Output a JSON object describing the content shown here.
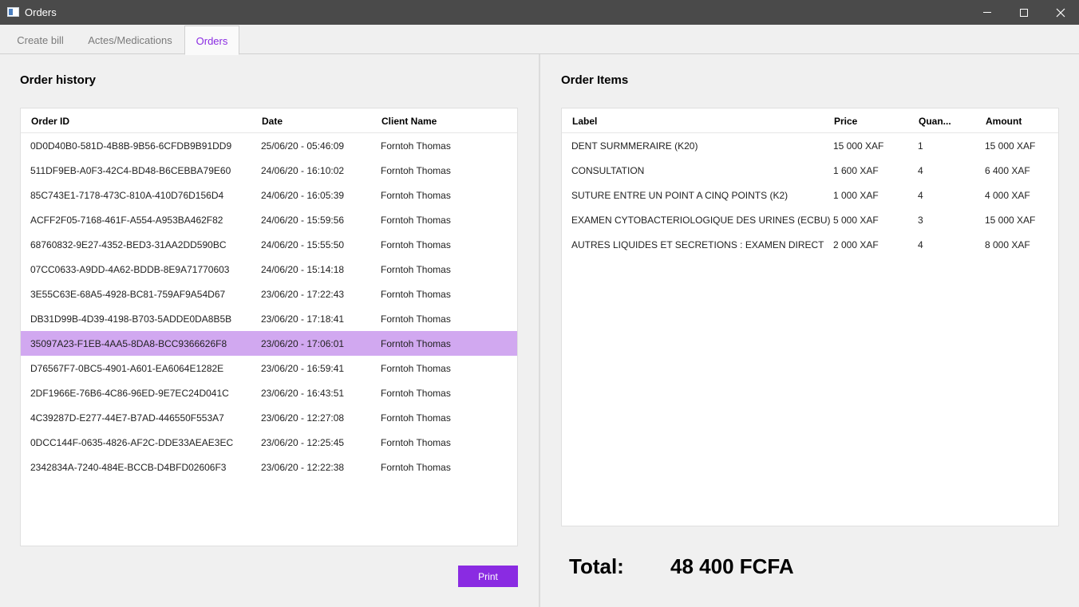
{
  "window": {
    "title": "Orders",
    "icon": "app-window-icon"
  },
  "tabs": [
    {
      "label": "Create bill",
      "active": false
    },
    {
      "label": "Actes/Medications",
      "active": false
    },
    {
      "label": "Orders",
      "active": true
    }
  ],
  "colors": {
    "accent": "#8a2be2",
    "selected_row": "#d1a8f0",
    "titlebar": "#4a4a4a"
  },
  "order_history": {
    "title": "Order history",
    "columns": [
      "Order ID",
      "Date",
      "Client Name"
    ],
    "selected_index": 8,
    "rows": [
      {
        "id": "0D0D40B0-581D-4B8B-9B56-6CFDB9B91DD9",
        "date": "25/06/20 - 05:46:09",
        "client": "Forntoh Thomas"
      },
      {
        "id": "511DF9EB-A0F3-42C4-BD48-B6CEBBA79E60",
        "date": "24/06/20 - 16:10:02",
        "client": "Forntoh Thomas"
      },
      {
        "id": "85C743E1-7178-473C-810A-410D76D156D4",
        "date": "24/06/20 - 16:05:39",
        "client": "Forntoh Thomas"
      },
      {
        "id": "ACFF2F05-7168-461F-A554-A953BA462F82",
        "date": "24/06/20 - 15:59:56",
        "client": "Forntoh Thomas"
      },
      {
        "id": "68760832-9E27-4352-BED3-31AA2DD590BC",
        "date": "24/06/20 - 15:55:50",
        "client": "Forntoh Thomas"
      },
      {
        "id": "07CC0633-A9DD-4A62-BDDB-8E9A71770603",
        "date": "24/06/20 - 15:14:18",
        "client": "Forntoh Thomas"
      },
      {
        "id": "3E55C63E-68A5-4928-BC81-759AF9A54D67",
        "date": "23/06/20 - 17:22:43",
        "client": "Forntoh Thomas"
      },
      {
        "id": "DB31D99B-4D39-4198-B703-5ADDE0DA8B5B",
        "date": "23/06/20 - 17:18:41",
        "client": "Forntoh Thomas"
      },
      {
        "id": "35097A23-F1EB-4AA5-8DA8-BCC9366626F8",
        "date": "23/06/20 - 17:06:01",
        "client": "Forntoh Thomas"
      },
      {
        "id": "D76567F7-0BC5-4901-A601-EA6064E1282E",
        "date": "23/06/20 - 16:59:41",
        "client": "Forntoh Thomas"
      },
      {
        "id": "2DF1966E-76B6-4C86-96ED-9E7EC24D041C",
        "date": "23/06/20 - 16:43:51",
        "client": "Forntoh Thomas"
      },
      {
        "id": "4C39287D-E277-44E7-B7AD-446550F553A7",
        "date": "23/06/20 - 12:27:08",
        "client": "Forntoh Thomas"
      },
      {
        "id": "0DCC144F-0635-4826-AF2C-DDE33AEAE3EC",
        "date": "23/06/20 - 12:25:45",
        "client": "Forntoh Thomas"
      },
      {
        "id": "2342834A-7240-484E-BCCB-D4BFD02606F3",
        "date": "23/06/20 - 12:22:38",
        "client": "Forntoh Thomas"
      }
    ],
    "print_label": "Print"
  },
  "order_items": {
    "title": "Order Items",
    "columns": [
      "Label",
      "Price",
      "Quan...",
      "Amount"
    ],
    "rows": [
      {
        "label": "DENT SURMMERAIRE (K20)",
        "price": "15 000 XAF",
        "qty": "1",
        "amount": "15 000 XAF"
      },
      {
        "label": "CONSULTATION",
        "price": "1 600 XAF",
        "qty": "4",
        "amount": "6 400 XAF"
      },
      {
        "label": "SUTURE ENTRE UN POINT A CINQ POINTS (K2)",
        "price": "1 000 XAF",
        "qty": "4",
        "amount": "4 000 XAF"
      },
      {
        "label": "EXAMEN CYTOBACTERIOLOGIQUE DES URINES (ECBU)",
        "price": "5 000 XAF",
        "qty": "3",
        "amount": "15 000 XAF"
      },
      {
        "label": "AUTRES LIQUIDES ET SECRETIONS : EXAMEN DIRECT",
        "price": "2 000 XAF",
        "qty": "4",
        "amount": "8 000 XAF"
      }
    ],
    "total_label": "Total:",
    "total_value": "48 400 FCFA"
  }
}
